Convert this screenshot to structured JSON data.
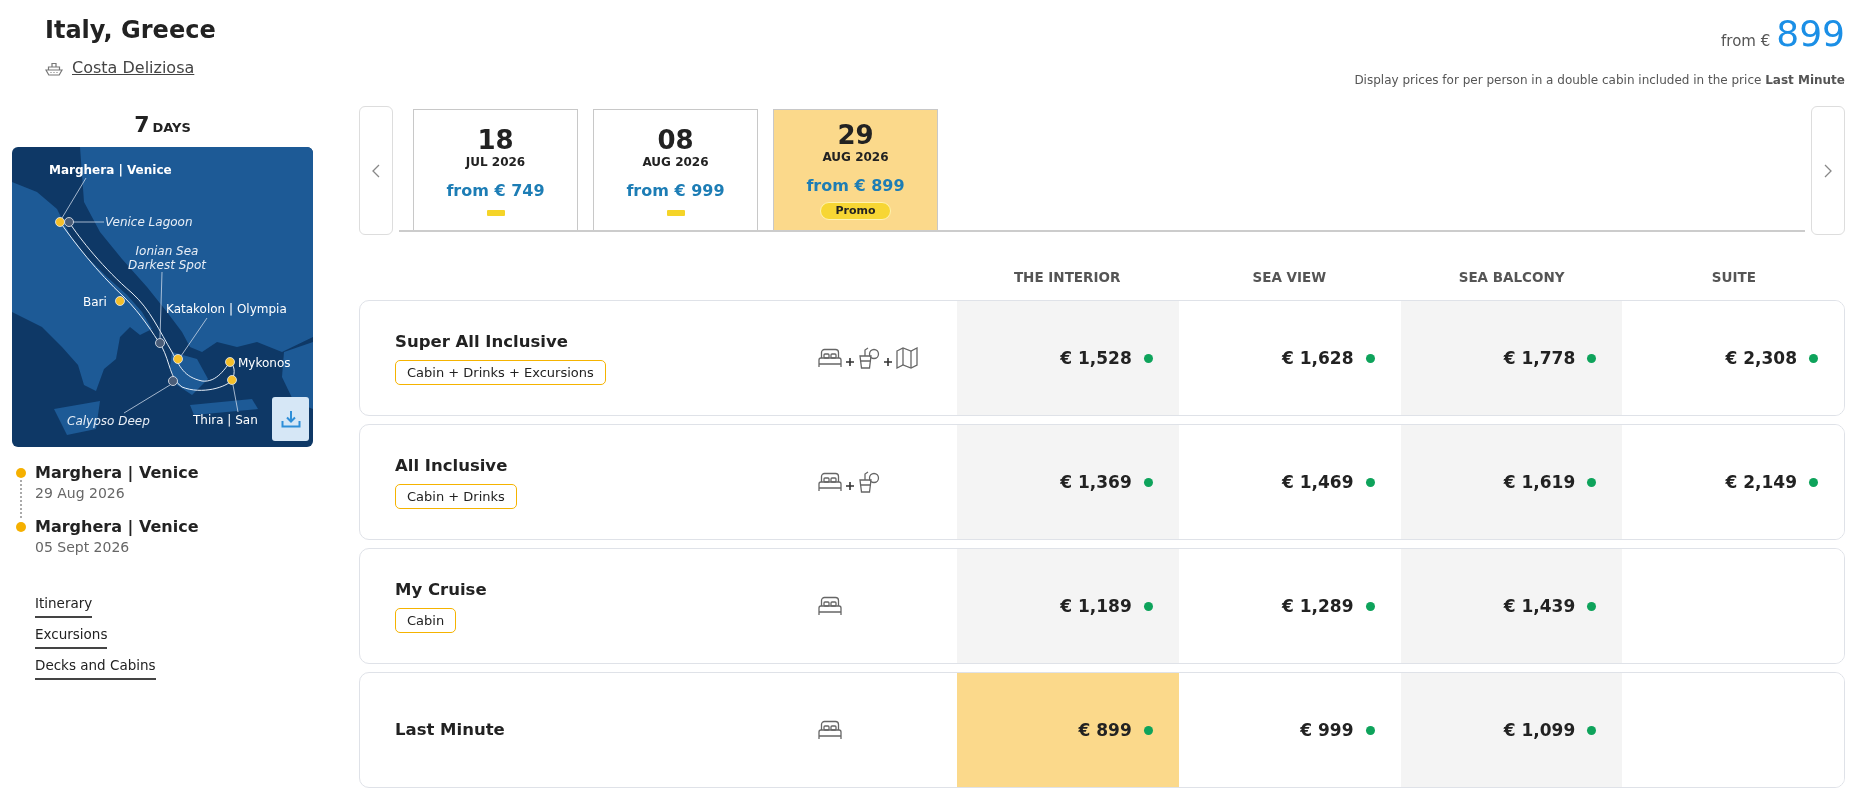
{
  "header": {
    "title": "Italy, Greece",
    "ship": "Costa Deliziosa",
    "price_prefix": "from €",
    "price": "899",
    "note": "Display prices for per person in a double cabin included in the price **Last Minute**"
  },
  "sidebar": {
    "duration": {
      "value": "7",
      "unit": "DAYS"
    },
    "map": {
      "labels": [
        {
          "name": "Marghera | Venice",
          "kind": "homeport"
        },
        {
          "name": "Venice Lagoon",
          "kind": "spot"
        },
        {
          "name": "Ionian Sea Darkest Spot",
          "kind": "spot"
        },
        {
          "name": "Bari",
          "kind": "port"
        },
        {
          "name": "Katakolon | Olympia",
          "kind": "port"
        },
        {
          "name": "Mykonos",
          "kind": "port"
        },
        {
          "name": "Calypso Deep",
          "kind": "spot"
        },
        {
          "name": "Thira | San",
          "kind": "port"
        }
      ]
    },
    "stops": [
      {
        "port": "Marghera | Venice",
        "date": "29 Aug 2026"
      },
      {
        "port": "Marghera | Venice",
        "date": "05 Sept 2026"
      }
    ],
    "links": [
      "Itinerary",
      "Excursions",
      "Decks and Cabins"
    ]
  },
  "dates": [
    {
      "day": "18",
      "month": "JUL 2026",
      "price": "from € 749",
      "flag": {
        "kind": "dash"
      },
      "selected": false
    },
    {
      "day": "08",
      "month": "AUG 2026",
      "price": "from € 999",
      "flag": {
        "kind": "dash"
      },
      "selected": false
    },
    {
      "day": "29",
      "month": "AUG 2026",
      "price": "from € 899",
      "flag": {
        "kind": "badge",
        "text": "Promo"
      },
      "selected": true
    }
  ],
  "columns": [
    "THE INTERIOR",
    "SEA VIEW",
    "SEA BALCONY",
    "SUITE"
  ],
  "packages": [
    {
      "name": "Super All Inclusive",
      "tag": "Cabin + Drinks + Excursions",
      "includes": [
        {
          "kind": "cabin"
        },
        {
          "kind": "drinks"
        },
        {
          "kind": "excursions"
        }
      ],
      "prices": [
        {
          "value": "€ 1,528",
          "available": true,
          "selected": false
        },
        {
          "value": "€ 1,628",
          "available": true,
          "selected": false
        },
        {
          "value": "€ 1,778",
          "available": true,
          "selected": false
        },
        {
          "value": "€ 2,308",
          "available": true,
          "selected": false
        }
      ]
    },
    {
      "name": "All Inclusive",
      "tag": "Cabin + Drinks",
      "includes": [
        {
          "kind": "cabin"
        },
        {
          "kind": "drinks"
        }
      ],
      "prices": [
        {
          "value": "€ 1,369",
          "available": true,
          "selected": false
        },
        {
          "value": "€ 1,469",
          "available": true,
          "selected": false
        },
        {
          "value": "€ 1,619",
          "available": true,
          "selected": false
        },
        {
          "value": "€ 2,149",
          "available": true,
          "selected": false
        }
      ]
    },
    {
      "name": "My Cruise",
      "tag": "Cabin",
      "includes": [
        {
          "kind": "cabin"
        }
      ],
      "prices": [
        {
          "value": "€ 1,189",
          "available": true,
          "selected": false
        },
        {
          "value": "€ 1,289",
          "available": true,
          "selected": false
        },
        {
          "value": "€ 1,439",
          "available": true,
          "selected": false
        }
      ]
    },
    {
      "name": "Last Minute",
      "includes": [
        {
          "kind": "cabin"
        }
      ],
      "prices": [
        {
          "value": "€ 899",
          "available": true,
          "selected": true
        },
        {
          "value": "€ 999",
          "available": true,
          "selected": false
        },
        {
          "value": "€ 1,099",
          "available": true,
          "selected": false
        }
      ]
    }
  ]
}
